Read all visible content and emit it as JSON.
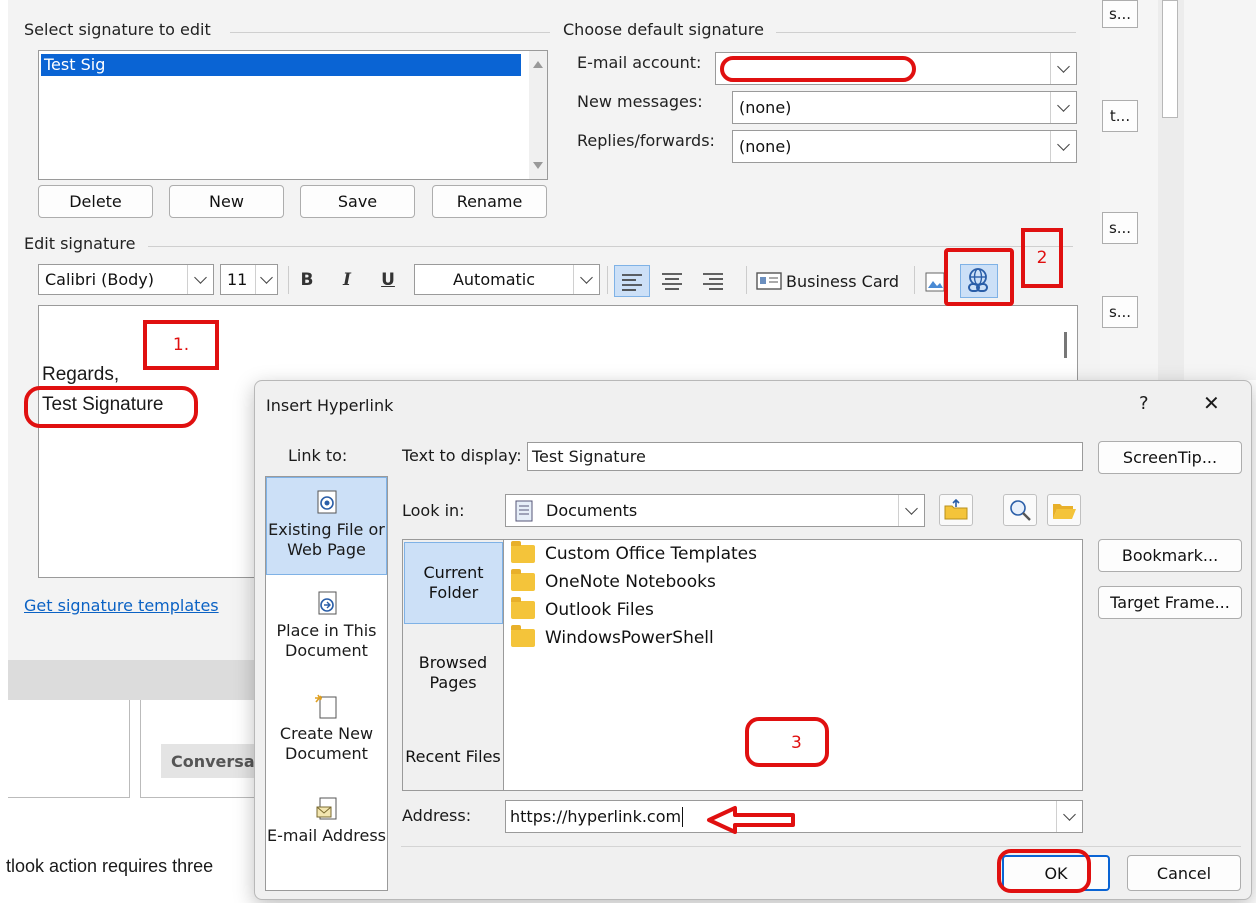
{
  "signature_editor": {
    "select_title": "Select signature to edit",
    "signatures": [
      "Test Sig"
    ],
    "delete": "Delete",
    "new": "New",
    "save": "Save",
    "rename": "Rename",
    "default_title": "Choose default signature",
    "email_account_label": "E-mail account:",
    "email_account_value": "",
    "new_messages_label": "New messages:",
    "new_messages_value": "(none)",
    "replies_label": "Replies/forwards:",
    "replies_value": "(none)",
    "edit_title": "Edit signature",
    "font_name": "Calibri (Body)",
    "font_size": "11",
    "bold": "B",
    "italic": "I",
    "underline": "U",
    "color": "Automatic",
    "business_card": "Business Card",
    "body_line1": "Regards,",
    "body_line2": "Test Signature",
    "templates_link": "Get signature templates"
  },
  "right_buttons": [
    "s...",
    "t...",
    "s...",
    "s..."
  ],
  "background": {
    "conversation_label": "Conversat",
    "footer_text": "tlook action requires three"
  },
  "annotations": {
    "step1": "1.",
    "step2": "2",
    "step3": "3"
  },
  "dialog": {
    "title": "Insert Hyperlink",
    "help": "?",
    "close": "✕",
    "link_to": "Link to:",
    "nav": [
      {
        "label": "Existing File or Web Page"
      },
      {
        "label": "Place in This Document"
      },
      {
        "label": "Create New Document"
      },
      {
        "label": "E-mail Address"
      }
    ],
    "text_to_display_label": "Text to display:",
    "text_to_display_value": "Test Signature",
    "screentip": "ScreenTip...",
    "look_in_label": "Look in:",
    "look_in_value": "Documents",
    "side": [
      "Current Folder",
      "Browsed Pages",
      "Recent Files"
    ],
    "files": [
      "Custom Office Templates",
      "OneNote Notebooks",
      "Outlook Files",
      "WindowsPowerShell"
    ],
    "bookmark": "Bookmark...",
    "target_frame": "Target Frame...",
    "address_label": "Address:",
    "address_value": "https://hyperlink.com",
    "ok": "OK",
    "cancel": "Cancel"
  }
}
